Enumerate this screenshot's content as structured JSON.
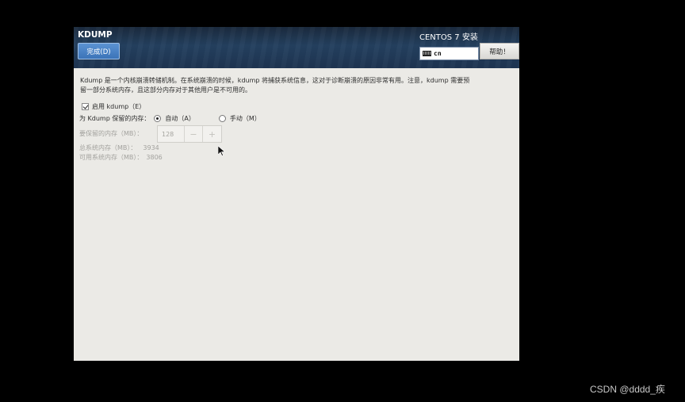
{
  "header": {
    "title": "KDUMP",
    "done_button": "完成(D)",
    "os_title": "CENTOS 7 安装",
    "keyboard_layout": "cn",
    "help_button": "帮助！"
  },
  "content": {
    "description_line1": "Kdump 是一个内核崩溃转储机制。在系统崩溃的时候，kdump 将捕获系统信息，这对于诊断崩溃的原因非常有用。注意，kdump 需要预",
    "description_line2": "留一部分系统内存，且这部分内存对于其他用户是不可用的。",
    "enable_checkbox_label": "启用 kdump（E）",
    "enable_checked": true,
    "reserve_label": "为 Kdump 保留的内存：",
    "auto_option": "自动（A）",
    "manual_option": "手动（M）",
    "selected_option": "auto",
    "reserve_mb_label": "要保留的内存（MB）：",
    "reserve_mb_value": "128",
    "minus_symbol": "−",
    "plus_symbol": "+",
    "total_memory_label": "总系统内存（MB）：",
    "total_memory_value": "3934",
    "usable_memory_label": "可用系统内存（MB）：",
    "usable_memory_value": "3806"
  },
  "watermark": "CSDN @dddd_疾",
  "colors": {
    "done_button": "#3b73b8",
    "header_bg": "#24405f",
    "content_bg": "#ebeae6"
  }
}
